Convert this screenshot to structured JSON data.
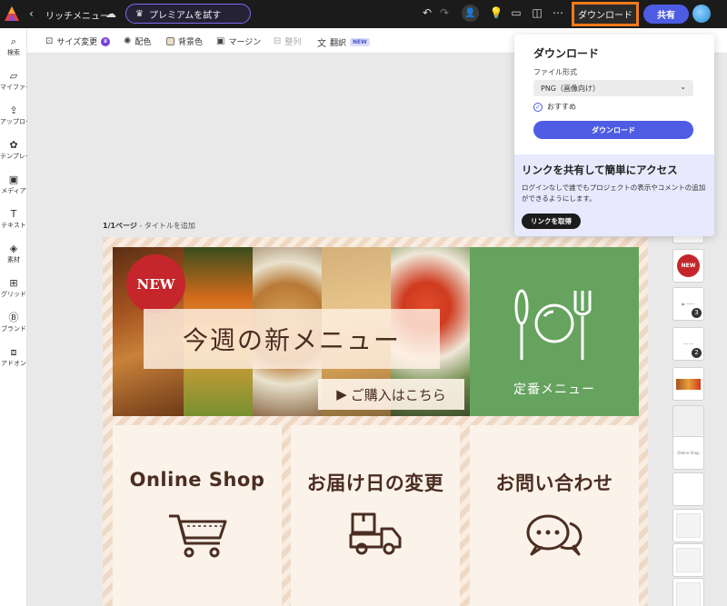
{
  "topbar": {
    "title": "リッチメニュー",
    "premium_label": "プレミアムを試す",
    "download_label": "ダウンロード",
    "share_label": "共有"
  },
  "sidebar": {
    "items": [
      {
        "label": "検索",
        "icon": "search-icon"
      },
      {
        "label": "マイファイル",
        "icon": "folder-icon"
      },
      {
        "label": "アップロード",
        "icon": "upload-icon"
      },
      {
        "label": "テンプレート",
        "icon": "template-icon"
      },
      {
        "label": "メディア",
        "icon": "media-icon"
      },
      {
        "label": "テキスト",
        "icon": "text-icon"
      },
      {
        "label": "素材",
        "icon": "elements-icon"
      },
      {
        "label": "グリッド",
        "icon": "grid-icon"
      },
      {
        "label": "ブランド",
        "icon": "brand-icon"
      },
      {
        "label": "アドオン",
        "icon": "addon-icon"
      }
    ]
  },
  "toolbar": {
    "resize": "サイズ変更",
    "color": "配色",
    "background": "背景色",
    "margin": "マージン",
    "align": "整列",
    "translate": "翻訳",
    "new_badge": "NEW"
  },
  "page": {
    "label": "1/1ページ",
    "add_title": "- タイトルを追加"
  },
  "design": {
    "new_badge": "NEW",
    "hero_title": "今週の新メニュー",
    "hero_button": "ご購入はこちら",
    "tile_standard": "定番メニュー",
    "tile_shop": "Online Shop",
    "tile_delivery": "お届け日の変更",
    "tile_contact": "お問い合わせ",
    "green_color": "#66a35e",
    "accent_red": "#c4262b",
    "text_brown": "#4b2d22"
  },
  "download_panel": {
    "title": "ダウンロード",
    "format_label": "ファイル形式",
    "format_value": "PNG（画像向け）",
    "recommended": "おすすめ",
    "download_button": "ダウンロード",
    "share_title": "リンクを共有して簡単にアクセス",
    "share_desc": "ログインなしで誰でもプロジェクトの表示やコメントの追加ができるようにします。",
    "link_button": "リンクを取得"
  },
  "page_strip": {
    "thumbs": [
      {
        "text": "",
        "badge": ""
      },
      {
        "text": "NEW",
        "badge": ""
      },
      {
        "text": "",
        "badge": "3"
      },
      {
        "text": "",
        "badge": "2"
      },
      {
        "text": "",
        "badge": ""
      },
      {
        "text": "",
        "badge": ""
      },
      {
        "text": "Online Shop",
        "badge": ""
      },
      {
        "text": "",
        "badge": ""
      },
      {
        "text": "",
        "badge": ""
      },
      {
        "text": "",
        "badge": ""
      },
      {
        "text": "",
        "badge": ""
      }
    ]
  },
  "colors": {
    "accent": "#4d5ce3",
    "highlight": "#f07a1a"
  }
}
